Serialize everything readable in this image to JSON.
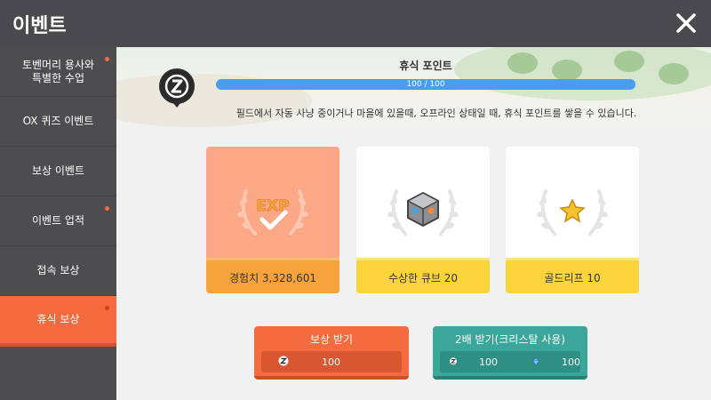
{
  "header": {
    "title": "이벤트"
  },
  "sidebar": {
    "items": [
      {
        "label": "토벤머리 용사와\n특별한 수업",
        "dot": true
      },
      {
        "label": "OX 퀴즈 이벤트",
        "dot": false
      },
      {
        "label": "보상 이벤트",
        "dot": false
      },
      {
        "label": "이벤트 업적",
        "dot": true
      },
      {
        "label": "접속 보상",
        "dot": false
      },
      {
        "label": "휴식 보상",
        "dot": true,
        "active": true
      }
    ]
  },
  "rest_points": {
    "title": "휴식 포인트",
    "progress_text": "100 / 100",
    "progress_fraction": 1.0,
    "description": "필드에서 자동 사냥 중이거나 마을에 있을때, 오프라인 상태일 때, 휴식 포인트를 쌓을 수 있습니다."
  },
  "rewards": [
    {
      "label": "경험치 3,328,601",
      "icon": "exp-icon",
      "claimed": true
    },
    {
      "label": "수상한 큐브 20",
      "icon": "cube-icon",
      "claimed": false
    },
    {
      "label": "골드리프 10",
      "icon": "gold-leaf-icon",
      "claimed": false
    }
  ],
  "buttons": {
    "claim": {
      "label": "보상 받기",
      "cost": "100"
    },
    "double_claim": {
      "label": "2배 받기(크리스탈 사용)",
      "cost": "100",
      "crystal_cost": "100"
    }
  },
  "colors": {
    "accent_orange": "#f36b3e",
    "teal": "#3aa79a",
    "progress_blue": "#4c9df0",
    "card_yellow": "#fbd33b"
  }
}
